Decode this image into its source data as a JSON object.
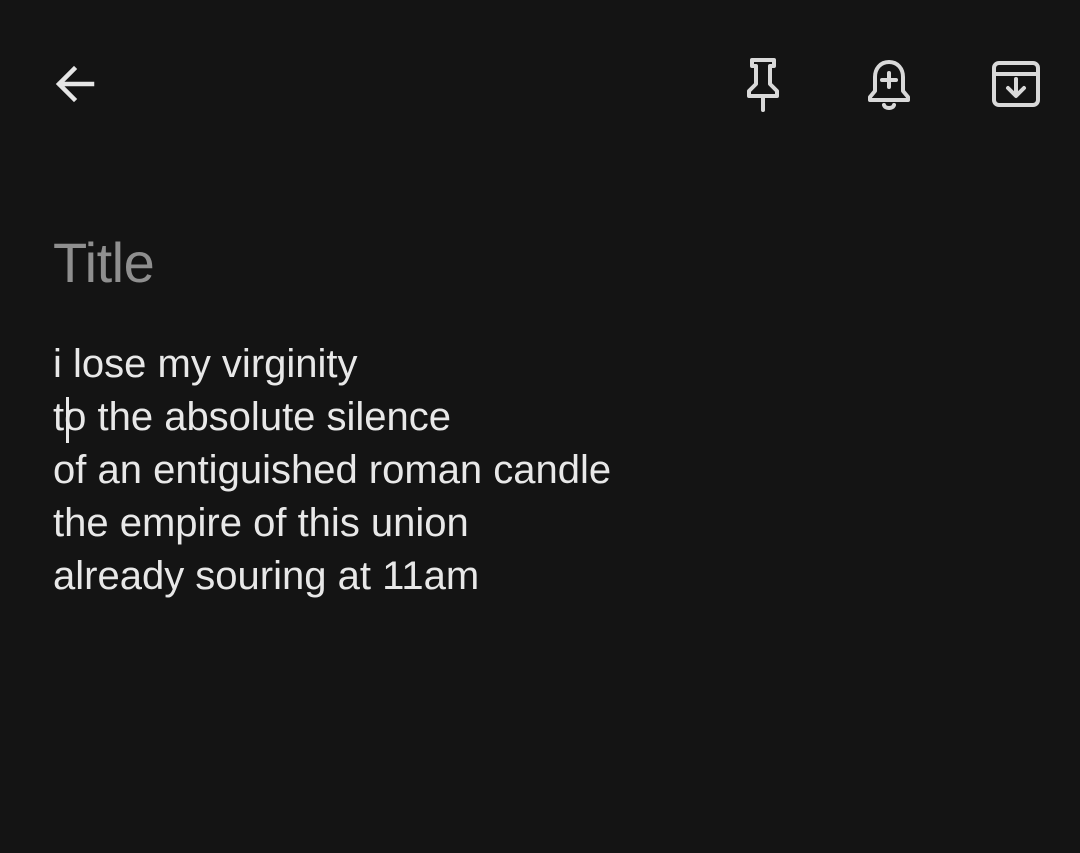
{
  "toolbar": {
    "back_icon": "arrow-left-icon",
    "pin_icon": "pin-icon",
    "reminder_icon": "bell-plus-icon",
    "archive_icon": "archive-icon"
  },
  "note": {
    "title_placeholder": "Title",
    "title_value": "",
    "body_lines": [
      "i lose my virginity",
      "to the absolute silence",
      "of an entiguished roman candle",
      "the empire of this union",
      "already souring at 11am"
    ]
  },
  "colors": {
    "background": "#141414",
    "text": "#e8e8e8",
    "placeholder": "#8f8f8f",
    "icon": "#d9d9d9"
  }
}
